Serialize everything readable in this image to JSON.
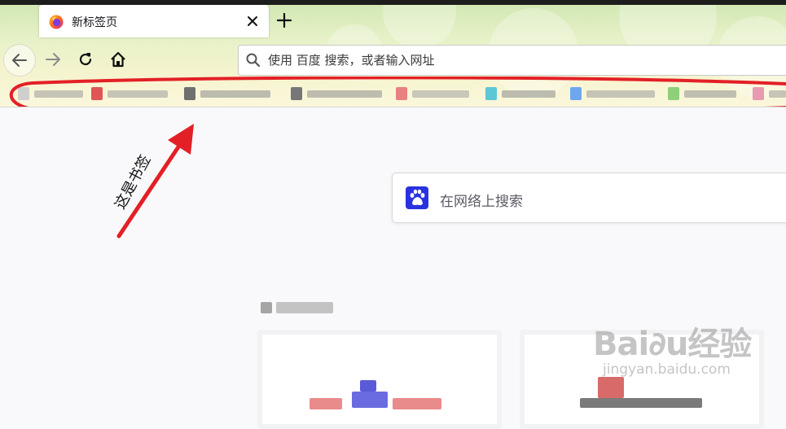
{
  "tab": {
    "title": "新标签页"
  },
  "urlbar": {
    "placeholder": "使用 百度 搜索，或者输入网址"
  },
  "annotation": {
    "label": "这是书签"
  },
  "search_box": {
    "placeholder": "在网络上搜索"
  },
  "watermark": {
    "logo": "Bai∂u经验",
    "url": "jingyan.baidu.com"
  },
  "icons": [
    "firefox-icon",
    "close-icon",
    "plus-icon",
    "back-arrow-icon",
    "forward-arrow-icon",
    "reload-icon",
    "home-icon",
    "search-icon",
    "baidu-paw-icon"
  ],
  "colors": {
    "annotation_red": "#e32026",
    "baidu_blue": "#2932e1"
  }
}
